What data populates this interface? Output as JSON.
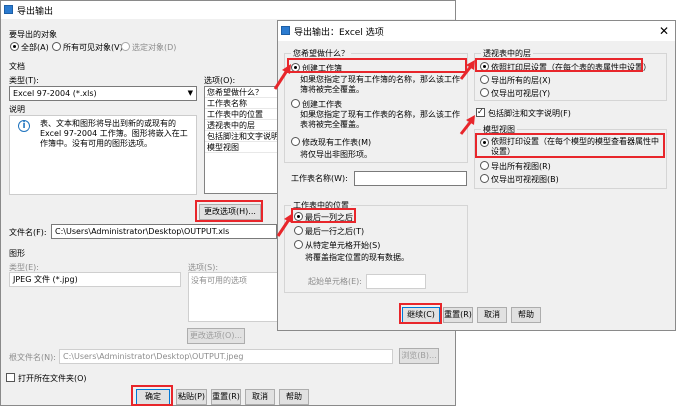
{
  "main": {
    "title": "导出输出",
    "objects_group": "要导出的对象",
    "opt_all": "全部(A)",
    "opt_visible": "所有可见对象(V)",
    "opt_selected": "选定对象(D)",
    "doc_group": "文档",
    "type_label": "类型(T):",
    "type_value": "Excel 97-2004 (*.xls)",
    "options_label": "选项(O):",
    "options_items": [
      "您希望做什么？",
      "工作表名称",
      "工作表中的位置",
      "透视表中的层",
      "包括脚注和文字说明",
      "模型视图"
    ],
    "desc_label": "说明",
    "desc_text": "表、文本和图形将导出到新的或现有的 Excel 97-2004 工作簿。图形将嵌入在工作簿中。没有可用的图形选项。",
    "change_options": "更改选项(H)...",
    "filename_label": "文件名(F):",
    "filename_value": "C:\\Users\\Administrator\\Desktop\\OUTPUT.xls",
    "graphics_group": "图形",
    "gtype_label": "类型(E):",
    "gtype_value": "JPEG 文件 (*.jpg)",
    "goptions_label": "选项(S):",
    "goptions_value": "没有可用的选项",
    "gchange_options": "更改选项(O)...",
    "rootname_label": "根文件名(N):",
    "rootname_value": "C:\\Users\\Administrator\\Desktop\\OUTPUT.jpeg",
    "browse": "浏览(B)...",
    "open_folder": "打开所在文件夹(O)",
    "ok": "确定",
    "paste": "粘贴(P)",
    "reset": "重置(R)",
    "cancel": "取消",
    "help": "帮助"
  },
  "dialog": {
    "title": "导出输出：Excel 选项",
    "q_group": "您希望做什么？",
    "opt_create_wb": "创建工作簿",
    "opt_create_wb_desc": "如果您指定了现有工作簿的名称，那么该工作簿将被完全覆盖。",
    "opt_create_ws": "创建工作表",
    "opt_create_ws_desc": "如果您指定了现有工作表的名称，那么该工作表将被完全覆盖。",
    "opt_modify_ws": "修改现有工作表(M)",
    "opt_modify_ws_desc": "将仅导出非图形项。",
    "sheet_name_label": "工作表名称(W):",
    "pos_group": "工作表中的位置",
    "pos_after_col": "最后一列之后",
    "pos_after_row": "最后一行之后(T)",
    "pos_from_cell": "从特定单元格开始(S)",
    "pos_from_cell_desc": "将覆盖指定位置的现有数据。",
    "start_cell_label": "起始单元格(E):",
    "layers_group": "透视表中的层",
    "layers_print": "依照打印层设置（在每个表的表属性中设置）",
    "layers_all": "导出所有的层(X)",
    "layers_visible": "仅导出可视层(Y)",
    "include_footnotes": "包括脚注和文字说明(F)",
    "model_group": "模型视图",
    "model_print": "依照打印设置（在每个模型的模型查看器属性中设置）",
    "model_all": "导出所有视图(R)",
    "model_visible": "仅导出可视视图(B)",
    "continue": "继续(C)",
    "reset": "重置(R)",
    "cancel": "取消",
    "help": "帮助"
  },
  "colors": {
    "highlight": "#e8262b",
    "focus": "#0078d7",
    "info": "#1e73be"
  },
  "icons": [
    "info-icon",
    "close-icon",
    "app-icon",
    "arrow-icon"
  ]
}
